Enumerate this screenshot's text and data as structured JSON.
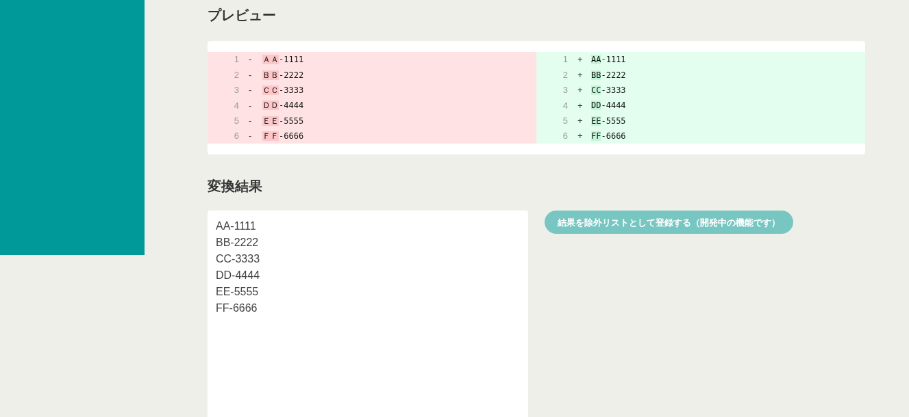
{
  "preview": {
    "title": "プレビュー",
    "sides": [
      {
        "kind": "removed",
        "lines": [
          {
            "number": "1",
            "sign": "-",
            "changed": "ＡＡ",
            "rest": "-1111"
          },
          {
            "number": "2",
            "sign": "-",
            "changed": "ＢＢ",
            "rest": "-2222"
          },
          {
            "number": "3",
            "sign": "-",
            "changed": "ＣＣ",
            "rest": "-3333"
          },
          {
            "number": "4",
            "sign": "-",
            "changed": "ＤＤ",
            "rest": "-4444"
          },
          {
            "number": "5",
            "sign": "-",
            "changed": "ＥＥ",
            "rest": "-5555"
          },
          {
            "number": "6",
            "sign": "-",
            "changed": "ＦＦ",
            "rest": "-6666"
          }
        ]
      },
      {
        "kind": "added",
        "lines": [
          {
            "number": "1",
            "sign": "+",
            "changed": "AA",
            "rest": "-1111"
          },
          {
            "number": "2",
            "sign": "+",
            "changed": "BB",
            "rest": "-2222"
          },
          {
            "number": "3",
            "sign": "+",
            "changed": "CC",
            "rest": "-3333"
          },
          {
            "number": "4",
            "sign": "+",
            "changed": "DD",
            "rest": "-4444"
          },
          {
            "number": "5",
            "sign": "+",
            "changed": "EE",
            "rest": "-5555"
          },
          {
            "number": "6",
            "sign": "+",
            "changed": "FF",
            "rest": "-6666"
          }
        ]
      }
    ]
  },
  "result": {
    "title": "変換結果",
    "textarea": {
      "value": "AA-1111\nBB-2222\nCC-3333\nDD-4444\nEE-5555\nFF-6666"
    },
    "button": {
      "label": "結果を除外リストとして登録する（開発中の機能です）",
      "disabled": true
    }
  }
}
